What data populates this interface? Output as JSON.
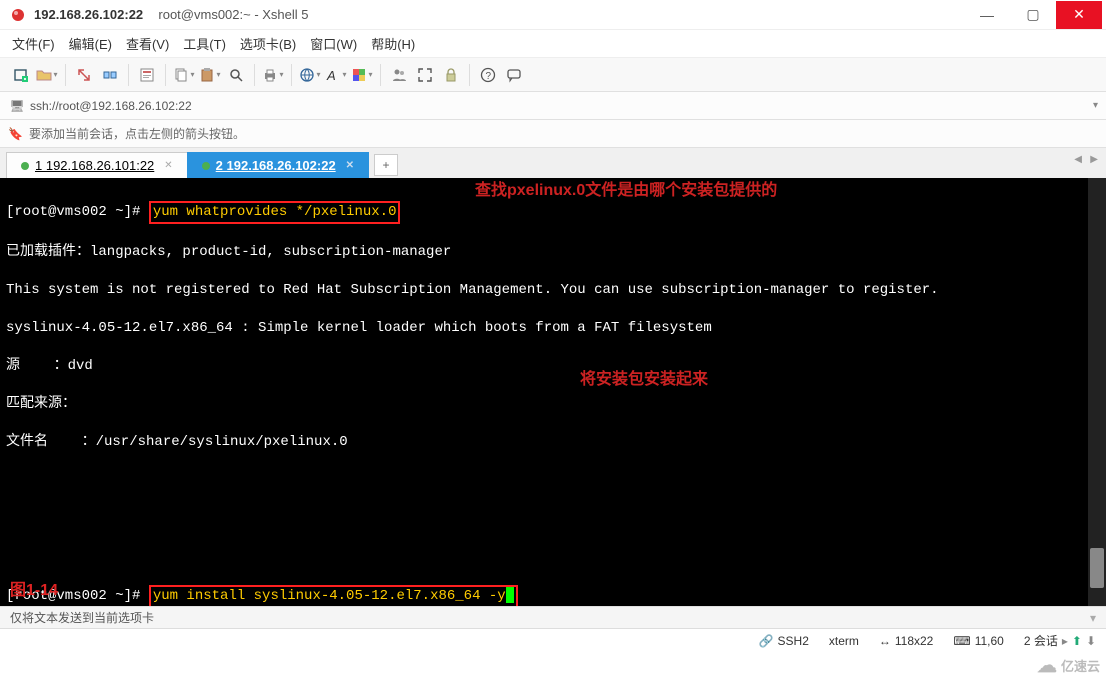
{
  "titlebar": {
    "main": "192.168.26.102:22",
    "sub": "root@vms002:~ - Xshell 5"
  },
  "menubar": {
    "file": "文件(F)",
    "edit": "编辑(E)",
    "view": "查看(V)",
    "tools": "工具(T)",
    "tabs": "选项卡(B)",
    "window": "窗口(W)",
    "help": "帮助(H)"
  },
  "addressbar": {
    "url": "ssh://root@192.168.26.102:22"
  },
  "hintbar": {
    "text": "要添加当前会话，点击左侧的箭头按钮。"
  },
  "tabs": {
    "t1": "1 192.168.26.101:22",
    "t2": "2 192.168.26.102:22"
  },
  "terminal": {
    "prompt1": "[root@vms002 ~]#",
    "cmd1": "yum whatprovides */pxelinux.0",
    "anno1": "查找pxelinux.0文件是由哪个安装包提供的",
    "l1": "已加载插件：langpacks, product-id, subscription-manager",
    "l2": "This system is not registered to Red Hat Subscription Management. You can use subscription-manager to register.",
    "l3": "syslinux-4.05-12.el7.x86_64 : Simple kernel loader which boots from a FAT filesystem",
    "l4": "源    ：dvd",
    "l5": "匹配来源：",
    "l6": "文件名    ：/usr/share/syslinux/pxelinux.0",
    "prompt2": "[root@vms002 ~]#",
    "cmd2": "yum install syslinux-4.05-12.el7.x86_64 -y",
    "anno2": "将安装包安装起来",
    "figure": "图1-14"
  },
  "footline": {
    "text": "仅将文本发送到当前选项卡"
  },
  "statusbar": {
    "proto": "SSH2",
    "term": "xterm",
    "size": "118x22",
    "pos": "11,60",
    "session": "2 会话"
  },
  "watermark": {
    "text": "亿速云"
  }
}
